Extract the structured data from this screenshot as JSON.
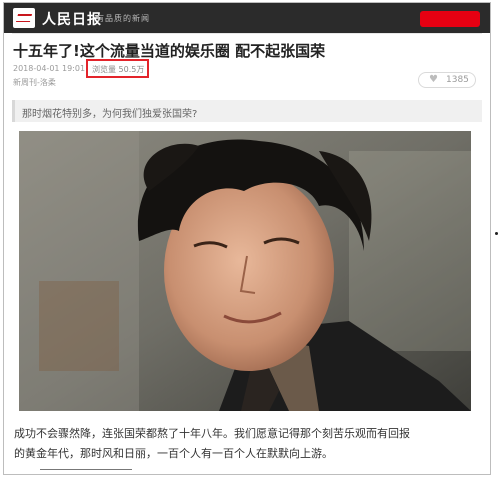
{
  "header": {
    "brand": "人民日报",
    "slogan": "有品质的新闻"
  },
  "article": {
    "title": "十五年了!这个流量当道的娱乐圈 配不起张国荣",
    "date": "2018-04-01 19:01",
    "views": "浏览量 50.5万",
    "source": "新周刊-洛柔",
    "likes": "1385",
    "quote": "那时烟花特别多，为何我们独爱张国荣?",
    "paragraph_line1": "成功不会骤然降，连张国荣都熬了十年八年。我们愿意记得那个刻苦乐观而有回报",
    "paragraph_line2": "的黄金年代，那时风和日丽，一百个人有一百个人在默默向上游。"
  },
  "icons": {
    "like": "heart-icon",
    "logo": "people-daily-logo-icon"
  },
  "colors": {
    "topbar": "#2b2b2b",
    "accent_red": "#e3242b"
  }
}
